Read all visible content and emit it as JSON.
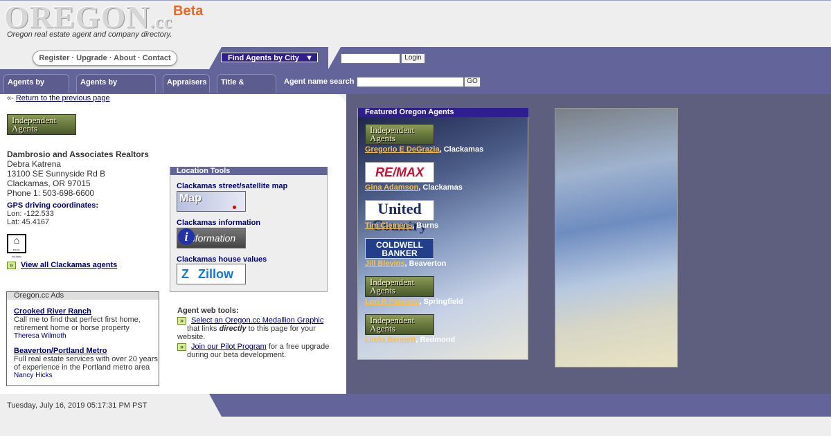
{
  "header": {
    "logo_main": "OREGON",
    "logo_suffix": ".cc",
    "beta": "Beta",
    "tagline": "Oregon real estate agent and company directory."
  },
  "topnav": {
    "register": "Register",
    "upgrade": "Upgrade",
    "about": "About",
    "contact": "Contact",
    "separator": " · ",
    "city_dropdown": "Find Agents by City",
    "dropdown_arrow": "▼",
    "login_button": "Login"
  },
  "tabs": [
    {
      "label": "Agents by name"
    },
    {
      "label": "Agents by company"
    },
    {
      "label": "Appraisers"
    },
    {
      "label": "Title & Escrow"
    }
  ],
  "search": {
    "label": "Agent name search",
    "button": "GO"
  },
  "back": {
    "prefix": "«- ",
    "link": "Return to the previous page"
  },
  "agent": {
    "logo_text": "Independent Agents",
    "company": "Dambrosio and Associates Realtors",
    "name": "Debra Katrena",
    "street": "13100 SE Sunnyside Rd B",
    "city_state": "Clackamas, OR 97015",
    "phone": "Phone 1: 503-698-6600",
    "gps_label": "GPS driving coordinates:",
    "lon": "Lon: -122.533",
    "lat": "Lat: 45.4167",
    "eho_text": "EQUAL HOUSING",
    "view_all": "View all Clackamas agents"
  },
  "ads": {
    "heading": "Oregon.cc Ads",
    "items": [
      {
        "title": "Crooked River Ranch",
        "text": "Call me to find that perfect first home, retirement home or horse property",
        "who": "Theresa Wilmoth"
      },
      {
        "title": "Beaverton/Portland Metro",
        "text": "Full real estate services with over 20 years of experience in the Portland metro area",
        "who": "Nancy Hicks"
      }
    ]
  },
  "location_tools": {
    "heading": "Location Tools",
    "map_label": "Clackamas street/satellite map",
    "map_img_text": "Map",
    "info_label": "Clackamas information",
    "info_img_text": "nformation",
    "info_img_i": "i",
    "zillow_label": "Clackamas house values",
    "zillow_img_text": "Zillow"
  },
  "web_tools": {
    "label": "Agent web tools:",
    "medallion_link": "Select an Oregon.cc Medallion Graphic",
    "medallion_text_a": "that links ",
    "medallion_text_em": "directly",
    "medallion_text_b": " to this page for your",
    "medallion_text_c": "website.",
    "pilot_link": "Join our Pilot Program",
    "pilot_text_a": " for a free upgrade",
    "pilot_text_b": "during our beta development."
  },
  "featured": {
    "heading": "Featured Oregon Agents",
    "agents": [
      {
        "logo": "Independent Agents",
        "logo_type": "independent",
        "name": "Gregorio E DeGrazia",
        "city": ", Clackamas"
      },
      {
        "logo": "RE/MAX",
        "logo_type": "remax",
        "name": "Gina Adamson",
        "city": ", Clackamas"
      },
      {
        "logo": "United Country",
        "logo_type": "united",
        "name": "Tim Clemens",
        "city": ", Burns"
      },
      {
        "logo": "COLDWELL BANKER",
        "logo_type": "coldwell",
        "name": "Jill Blevins",
        "city": ", Beaverton"
      },
      {
        "logo": "Independent Agents",
        "logo_type": "independent",
        "name": "Lori R Palermo",
        "city": ", Springfield"
      },
      {
        "logo": "Independent Agents",
        "logo_type": "independent",
        "name": "Linda Bennett",
        "city": ", Redmond"
      }
    ]
  },
  "footer": {
    "date": "Tuesday, July 16, 2019 05:17:31 PM PST"
  },
  "colors": {
    "band": "#636499",
    "dropdown": "#2f1e8f",
    "beta": "#ee6622",
    "link": "#00007a",
    "featured_link": "#f6c24c"
  }
}
